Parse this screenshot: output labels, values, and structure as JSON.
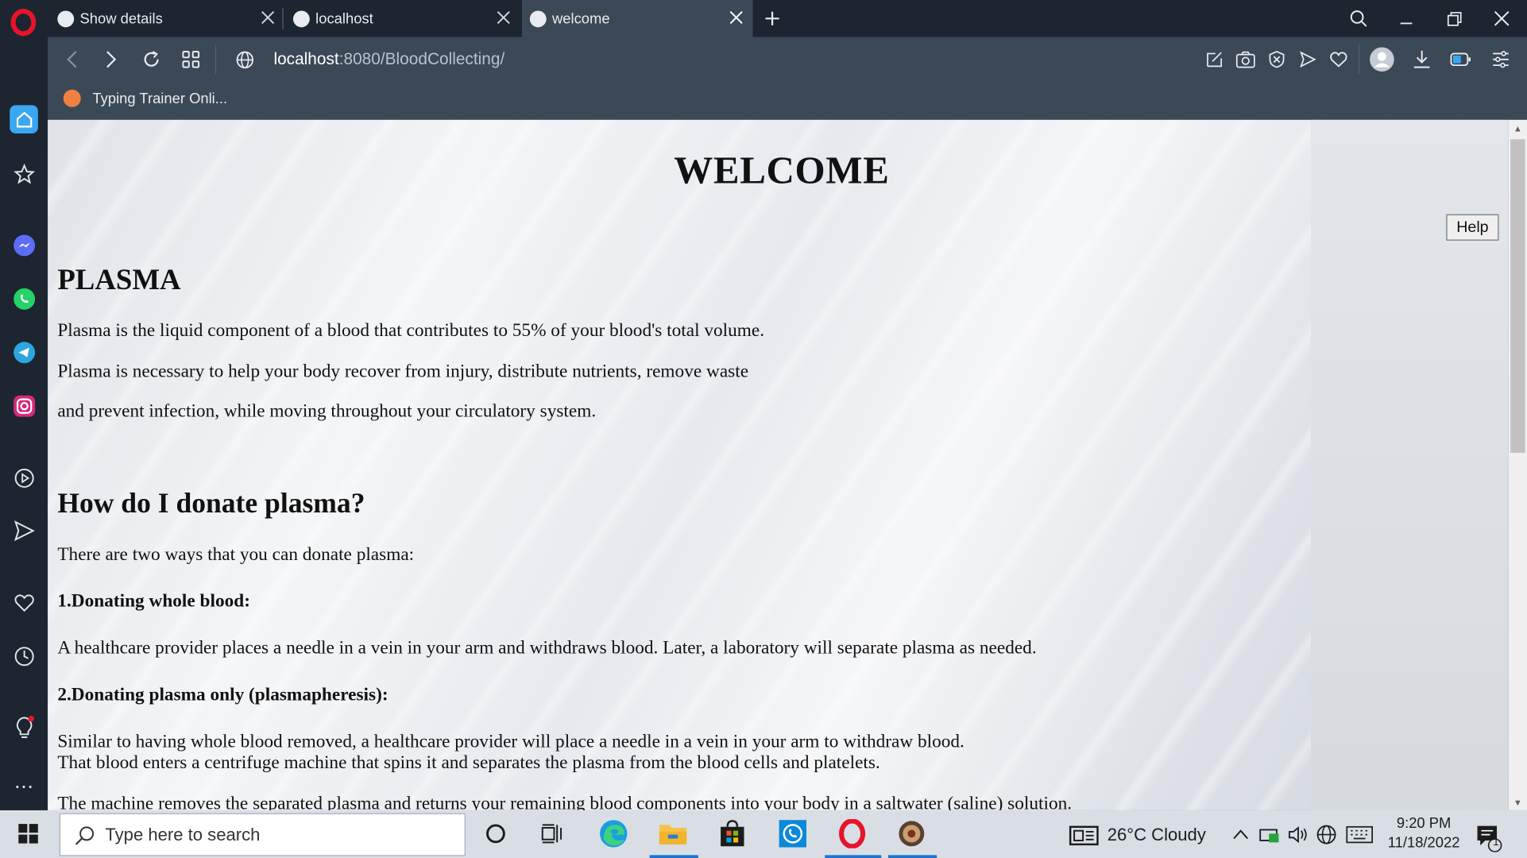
{
  "browser": {
    "tabs": [
      {
        "title": "Show details",
        "active": false
      },
      {
        "title": "localhost",
        "active": false
      },
      {
        "title": "welcome",
        "active": true
      }
    ],
    "address": {
      "host": "localhost",
      "rest": ":8080/BloodCollecting/"
    },
    "bookmark": "Typing Trainer Onli..."
  },
  "page": {
    "heading": "WELCOME",
    "help_label": "Help",
    "plasma_title": "PLASMA",
    "plasma_p1": "Plasma is the liquid component of a blood that contributes to 55% of your blood's total volume.",
    "plasma_p2": "Plasma is necessary to help your body recover from injury, distribute nutrients, remove waste",
    "plasma_p3": "and prevent infection, while moving throughout your circulatory system.",
    "donate_title": "How do I donate plasma?",
    "donate_intro": "There are two ways that you can donate plasma:",
    "way1_title": "1.Donating whole blood:",
    "way1_text": "A healthcare provider places a needle in a vein in your arm and withdraws blood. Later, a laboratory will separate plasma as needed.",
    "way2_title": "2.Donating plasma only (plasmapheresis):",
    "way2_text1": "Similar to having whole blood removed, a healthcare provider will place a needle in a vein in your arm to withdraw blood.",
    "way2_text2": "That blood enters a centrifuge machine that spins it and separates the plasma from the blood cells and platelets.",
    "way2_text3": "The machine removes the separated plasma and returns your remaining blood components into your body in a saltwater (saline) solution."
  },
  "taskbar": {
    "search_placeholder": "Type here to search",
    "weather": "26°C  Cloudy",
    "time": "9:20 PM",
    "date": "11/18/2022",
    "notification_count": "1"
  },
  "colors": {
    "browser_dark": "#1c2530",
    "browser_toolbar": "#3b4856",
    "opera_red": "#e8132a",
    "home_blue": "#3aa7f0",
    "taskbar": "#d9dee5"
  }
}
